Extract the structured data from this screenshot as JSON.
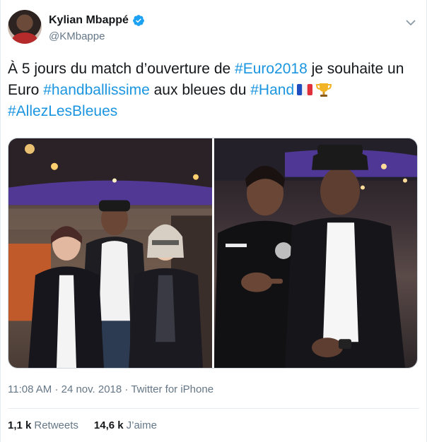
{
  "user": {
    "display_name": "Kylian Mbappé",
    "handle": "@KMbappe",
    "verified": true
  },
  "tweet": {
    "text_parts": [
      {
        "type": "text",
        "value": "À 5 jours du match d’ouverture de "
      },
      {
        "type": "hashtag",
        "value": "#Euro2018"
      },
      {
        "type": "text",
        "value": " je souhaite un Euro "
      },
      {
        "type": "hashtag",
        "value": "#handballissime"
      },
      {
        "type": "text",
        "value": " aux bleues du "
      },
      {
        "type": "hashtag",
        "value": "#Hand"
      },
      {
        "type": "emoji",
        "value": "france-flag-icon"
      },
      {
        "type": "emoji",
        "value": "trophy-icon"
      },
      {
        "type": "text",
        "value": " "
      },
      {
        "type": "hashtag",
        "value": "#AllezLesBleues"
      }
    ],
    "photos": [
      "photo-group-three-people",
      "photo-two-people-pointing"
    ],
    "time": "11:08 AM",
    "date": "24 nov. 2018",
    "separator": "·",
    "source": "Twitter for iPhone"
  },
  "stats": {
    "retweets_count": "1,1 k",
    "retweets_label": "Retweets",
    "likes_count": "14,6 k",
    "likes_label": "J’aime"
  },
  "colors": {
    "link": "#1b95e0",
    "text": "#14171a",
    "muted": "#657786",
    "divider": "#e6ecf0"
  }
}
